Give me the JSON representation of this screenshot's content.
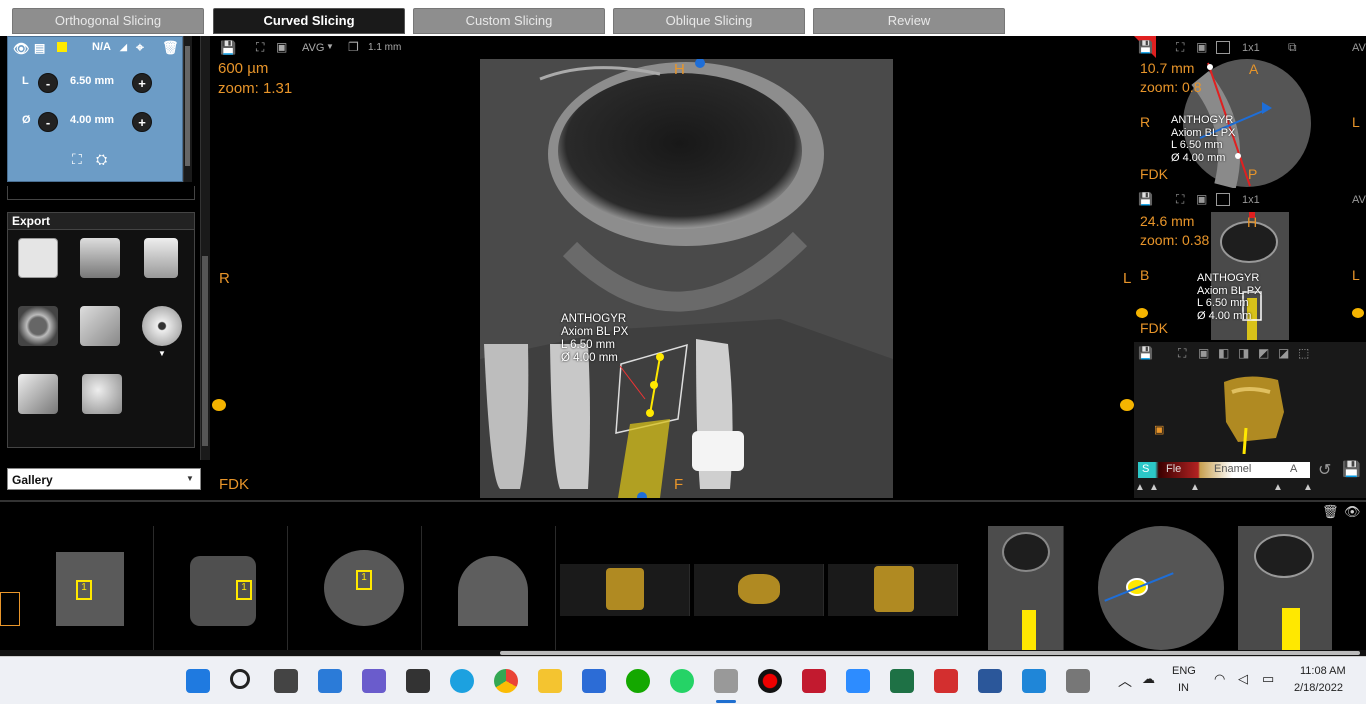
{
  "tabs": [
    {
      "label": "Orthogonal Slicing"
    },
    {
      "label": "Curved Slicing"
    },
    {
      "label": "Custom Slicing"
    },
    {
      "label": "Oblique Slicing"
    },
    {
      "label": "Review"
    }
  ],
  "implant_panel": {
    "na_label": "N/A",
    "length_label": "L",
    "length_value": "6.50 mm",
    "diameter_label": "Ø",
    "diameter_value": "4.00 mm",
    "minus": "-",
    "plus": "+"
  },
  "export": {
    "title": "Export"
  },
  "gallery": {
    "title": "Gallery"
  },
  "main_view": {
    "toolbar_mode": "AVG",
    "toolbar_thickness": "1.1 mm",
    "thickness": "600 µm",
    "zoom": "zoom: 1.31",
    "orient_top": "H",
    "orient_bottom": "F",
    "orient_left": "R",
    "orient_right": "L",
    "fdk": "FDK",
    "implant_brand": "ANTHOGYR",
    "implant_model": "Axiom BL PX",
    "implant_length": "L 6.50 mm",
    "implant_diameter": "Ø 4.00 mm"
  },
  "right_top": {
    "layout": "1x1",
    "size": "10.7 mm",
    "zoom": "zoom: 0.8",
    "orient_top": "A",
    "orient_bottom": "P",
    "orient_left": "R",
    "orient_right": "L",
    "fdk": "FDK",
    "implant_brand": "ANTHOGYR",
    "implant_model": "Axiom BL PX",
    "implant_length": "L 6.50 mm",
    "implant_diameter": "Ø 4.00 mm",
    "side_label": "AV"
  },
  "right_mid": {
    "layout": "1x1",
    "size": "24.6 mm",
    "zoom": "zoom: 0.38",
    "orient_top": "H",
    "orient_left": "B",
    "orient_right": "L",
    "fdk": "FDK",
    "implant_brand": "ANTHOGYR",
    "implant_model": "Axiom BL PX",
    "implant_length": "L 6.50 mm",
    "implant_diameter": "Ø 4.00 mm",
    "side_label": "AV"
  },
  "render3d": {
    "tissue_s": "S",
    "tissue_fle": "Fle",
    "tissue_enamel": "Enamel",
    "tissue_a": "A"
  },
  "thumbs": {
    "badge": "1"
  },
  "taskbar": {
    "lang_top": "ENG",
    "lang_bottom": "IN",
    "time": "11:08 AM",
    "date": "2/18/2022"
  }
}
